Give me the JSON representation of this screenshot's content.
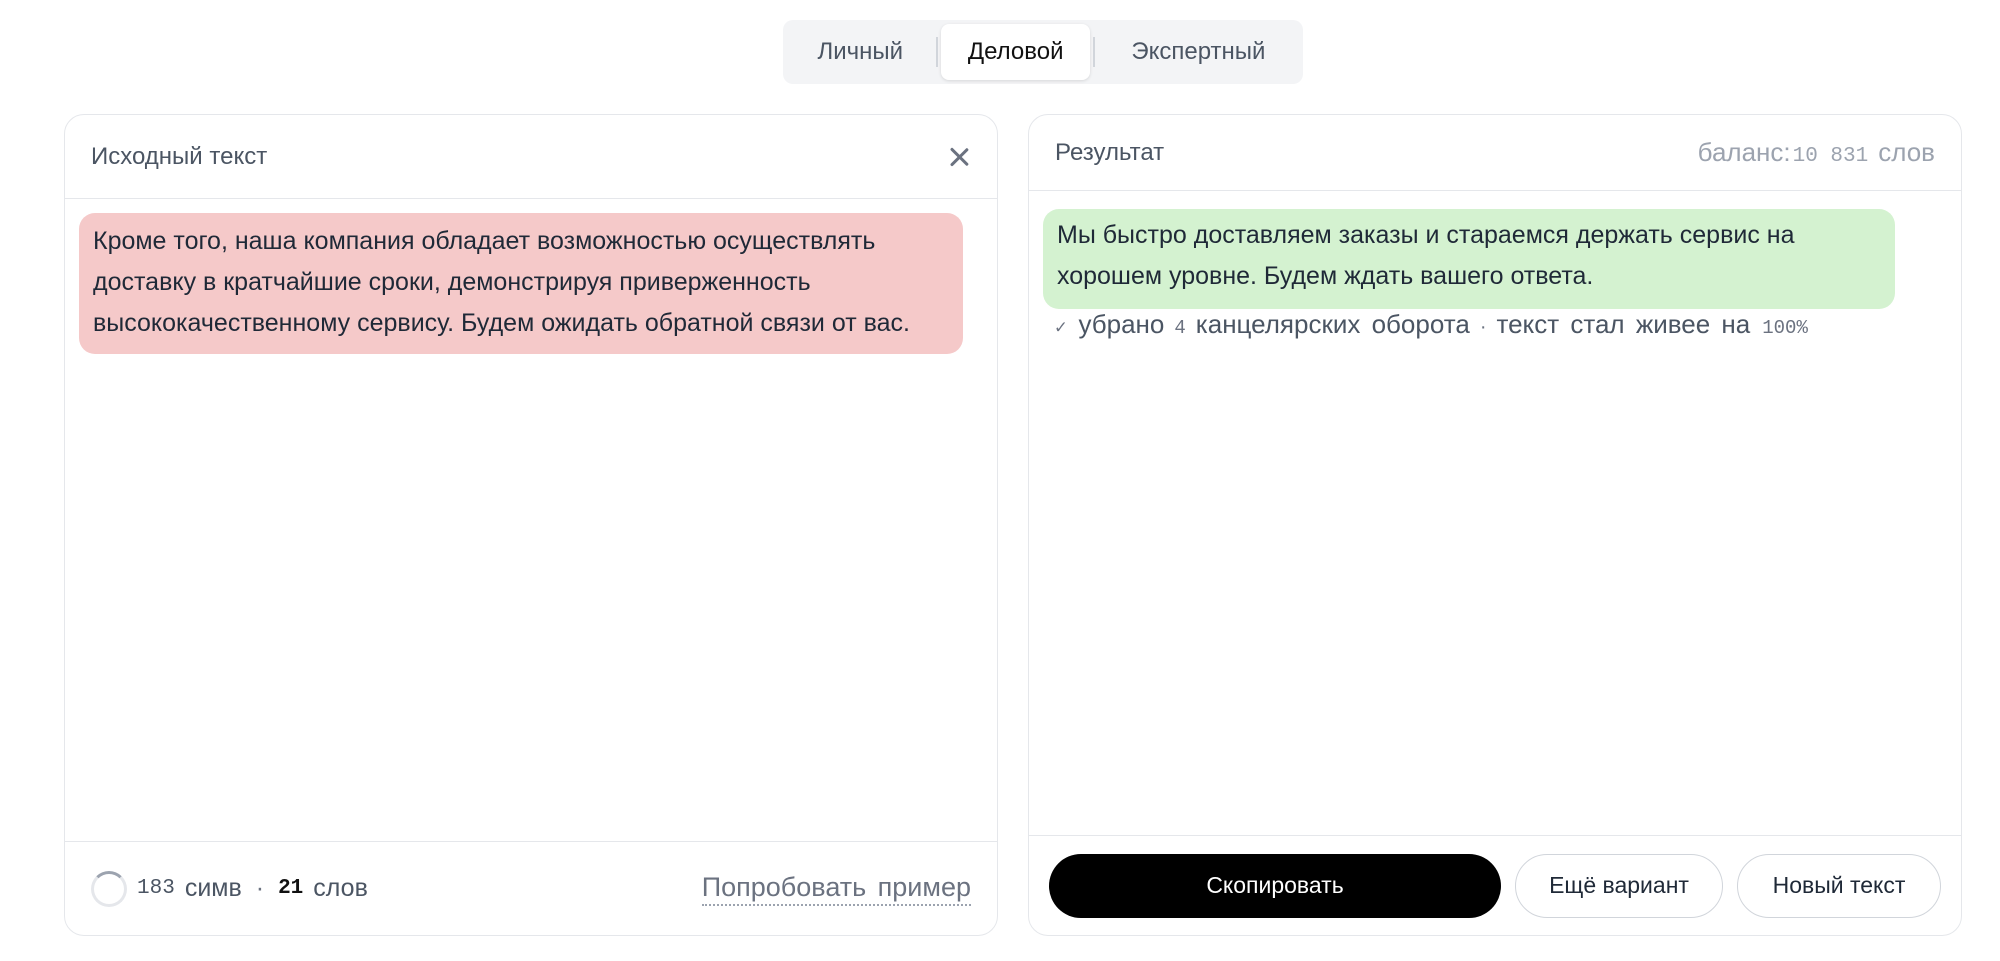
{
  "modes": {
    "items": [
      "Личный",
      "Деловой",
      "Экспертный"
    ],
    "active": "Деловой"
  },
  "source": {
    "title": "Исходный текст",
    "text": "Кроме того, наша компания обладает возможностью осуществлять доставку в кратчайшие сроки, демонстрируя приверженность высококачественному сервису. Будем ожидать обратной связи от вас.",
    "chars_count": "183",
    "chars_unit": "симв",
    "separator": "·",
    "words_count": "21",
    "words_unit": "слов",
    "try_example": "Попробовать пример"
  },
  "result": {
    "title": "Результат",
    "balance_label": "баланс:",
    "balance_value": "10 831",
    "balance_unit": "слов",
    "text": "Мы быстро доставляем заказы и стараемся держать сервис на хорошем уровне. Будем ждать вашего ответа.",
    "stats": {
      "check": "✓",
      "removed_label": "убрано",
      "removed_count": "4",
      "removed_unit": "канцелярских оборота",
      "separator": "·",
      "livelier_label": "текст стал живее на",
      "livelier_value": "100%"
    }
  },
  "actions": {
    "copy": "Скопировать",
    "more": "Ещё вариант",
    "new": "Новый текст"
  }
}
